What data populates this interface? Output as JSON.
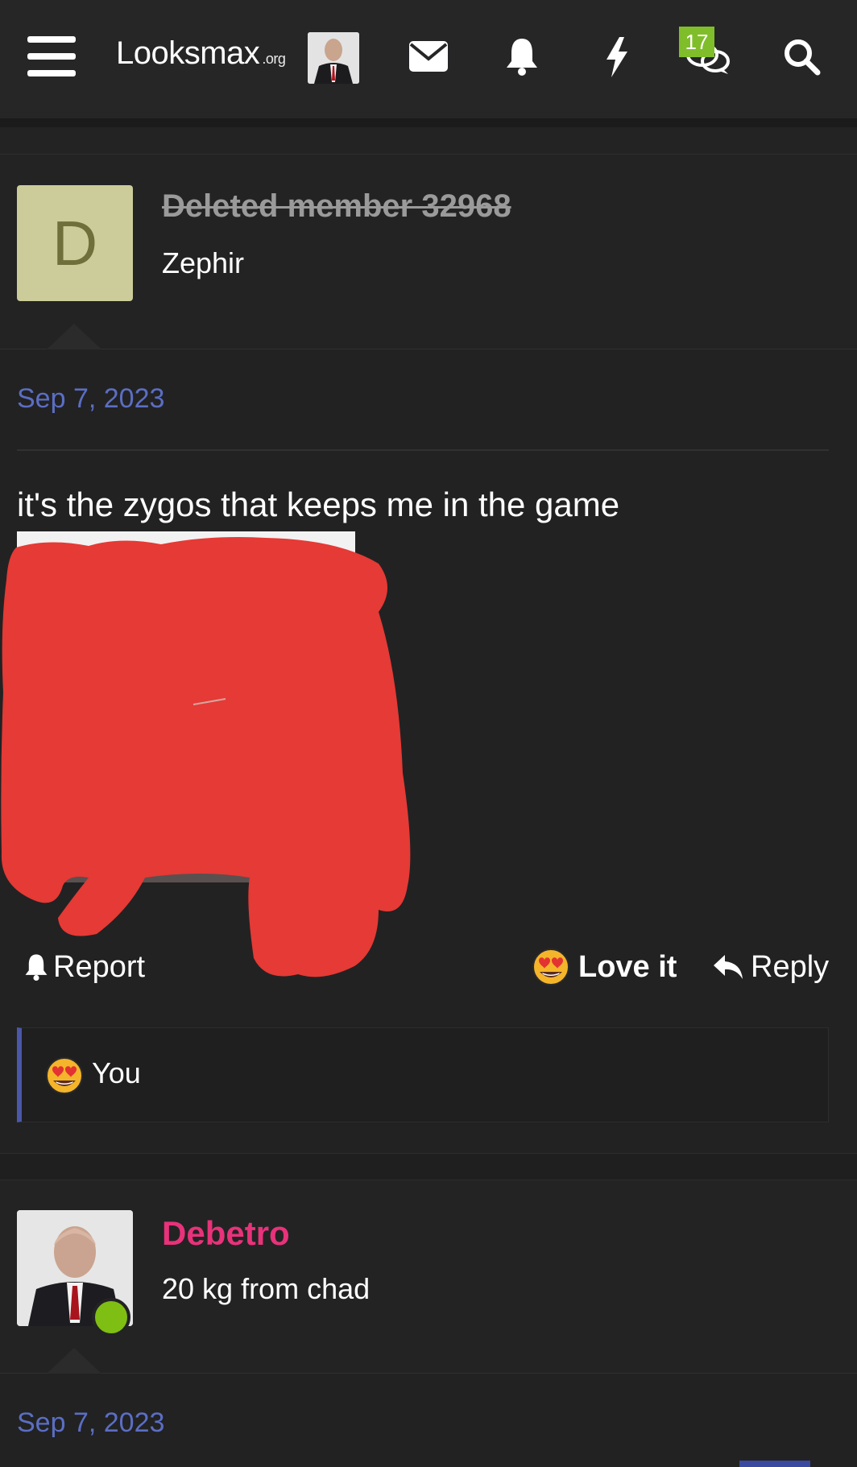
{
  "nav": {
    "logo_main": "Looksmax",
    "logo_tld": ".org",
    "conversations_badge": "17",
    "icons": [
      "menu-icon",
      "avatar",
      "envelope-icon",
      "bell-icon",
      "bolt-icon",
      "chat-icon",
      "search-icon"
    ]
  },
  "post1": {
    "avatar_letter": "D",
    "username": "Deleted member 32968",
    "user_title": "Zephir",
    "date": "Sep 7, 2023",
    "text": "it's the zygos that keeps me in the game",
    "actions": {
      "report": "Report",
      "reaction": "Love it",
      "reply": "Reply"
    },
    "reactions_summary": "You"
  },
  "post2": {
    "username": "Debetro",
    "user_title": "20 kg from chad",
    "date": "Sep 7, 2023"
  },
  "colors": {
    "background": "#222223",
    "link_date": "#5b6ec3",
    "username_highlight": "#e8327a",
    "badge_green": "#7fbe2a",
    "redaction_red": "#e53a35"
  }
}
